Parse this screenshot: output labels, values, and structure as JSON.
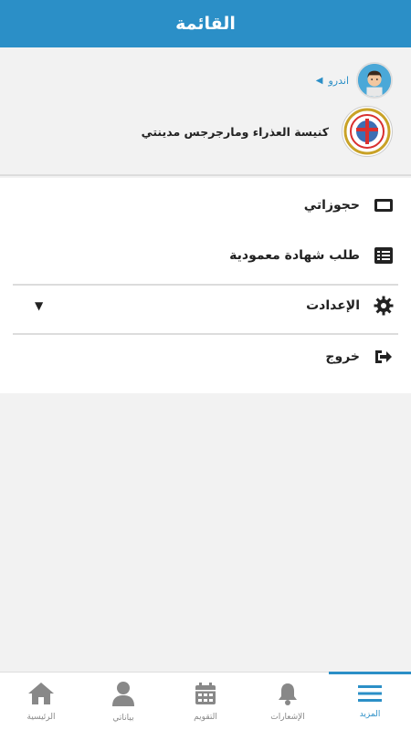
{
  "header": {
    "title": "القائمة"
  },
  "profile": {
    "user_name": "اندرو",
    "church_name": "كنيسة العذراء ومارجرجس مدينتي"
  },
  "menu": {
    "items": [
      {
        "label": "حجوزاتي",
        "icon": "ticket-icon"
      },
      {
        "label": "طلب شهادة معمودية",
        "icon": "list-icon"
      },
      {
        "label": "الإعدادت",
        "icon": "gear-icon"
      },
      {
        "label": "خروج",
        "icon": "logout-icon"
      }
    ]
  },
  "tabs": [
    {
      "label": "المزيد",
      "icon": "menu-icon",
      "active": true
    },
    {
      "label": "الإشعارات",
      "icon": "bell-icon"
    },
    {
      "label": "التقويم",
      "icon": "calendar-icon"
    },
    {
      "label": "بياناتي",
      "icon": "user-icon"
    },
    {
      "label": "الرئيسية",
      "icon": "home-icon"
    }
  ],
  "colors": {
    "primary": "#2b8fc7",
    "background": "#f2f2f2"
  }
}
